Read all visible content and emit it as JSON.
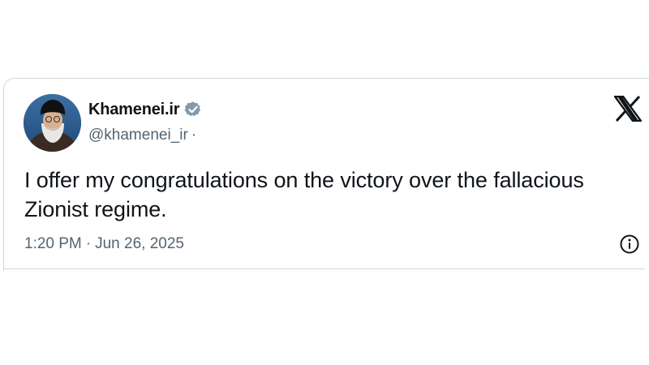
{
  "tweet": {
    "display_name": "Khamenei.ir",
    "handle": "@khamenei_ir",
    "handle_separator": "·",
    "text": "I offer my congratulations on the victory over the fallacious Zionist regime.",
    "time": "1:20 PM",
    "time_separator": "·",
    "date": "Jun 26, 2025"
  },
  "icons": {
    "verified": "verified-badge-icon",
    "platform_logo": "x-logo-icon",
    "info": "info-icon",
    "avatar": "profile-avatar"
  },
  "colors": {
    "verified_badge": "#829aab",
    "text_primary": "#0f1419",
    "text_secondary": "#536471",
    "border": "#cfd9de"
  }
}
